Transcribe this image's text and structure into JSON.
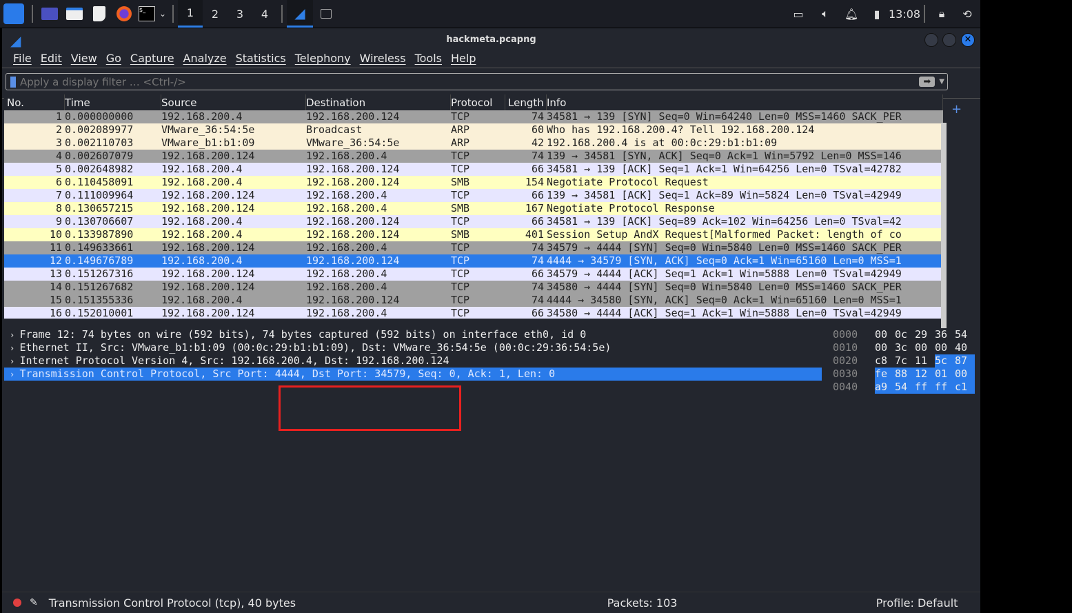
{
  "taskbar": {
    "workspaces": [
      "1",
      "2",
      "3",
      "4"
    ],
    "active_workspace": "1",
    "clock": "13:08"
  },
  "window": {
    "title": "hackmeta.pcapng"
  },
  "menu": [
    "File",
    "Edit",
    "View",
    "Go",
    "Capture",
    "Analyze",
    "Statistics",
    "Telephony",
    "Wireless",
    "Tools",
    "Help"
  ],
  "filter": {
    "placeholder": "Apply a display filter … <Ctrl-/>"
  },
  "columns": [
    "No.",
    "Time",
    "Source",
    "Destination",
    "Protocol",
    "Length",
    "Info"
  ],
  "colors": {
    "syn": "#a0a0a0",
    "arp": "#faf0d7",
    "tcp": "#e7e6ff",
    "smb": "#ffffc0",
    "selected": "#2a7bea",
    "accent": "#2f7fe6"
  },
  "packets": [
    [
      "1",
      "0.000000000",
      "192.168.200.4",
      "192.168.200.124",
      "TCP",
      "74",
      "34581 → 139 [SYN] Seq=0 Win=64240 Len=0 MSS=1460 SACK_PER",
      "syn"
    ],
    [
      "2",
      "0.002089977",
      "VMware_36:54:5e",
      "Broadcast",
      "ARP",
      "60",
      "Who has 192.168.200.4? Tell 192.168.200.124",
      "arp"
    ],
    [
      "3",
      "0.002110703",
      "VMware_b1:b1:09",
      "VMware_36:54:5e",
      "ARP",
      "42",
      "192.168.200.4 is at 00:0c:29:b1:b1:09",
      "arp"
    ],
    [
      "4",
      "0.002607079",
      "192.168.200.124",
      "192.168.200.4",
      "TCP",
      "74",
      "139 → 34581 [SYN, ACK] Seq=0 Ack=1 Win=5792 Len=0 MSS=146",
      "syn"
    ],
    [
      "5",
      "0.002648982",
      "192.168.200.4",
      "192.168.200.124",
      "TCP",
      "66",
      "34581 → 139 [ACK] Seq=1 Ack=1 Win=64256 Len=0 TSval=42782",
      "tcp"
    ],
    [
      "6",
      "0.110458091",
      "192.168.200.4",
      "192.168.200.124",
      "SMB",
      "154",
      "Negotiate Protocol Request",
      "smb"
    ],
    [
      "7",
      "0.111009964",
      "192.168.200.124",
      "192.168.200.4",
      "TCP",
      "66",
      "139 → 34581 [ACK] Seq=1 Ack=89 Win=5824 Len=0 TSval=42949",
      "tcp"
    ],
    [
      "8",
      "0.130657215",
      "192.168.200.124",
      "192.168.200.4",
      "SMB",
      "167",
      "Negotiate Protocol Response",
      "smb"
    ],
    [
      "9",
      "0.130706607",
      "192.168.200.4",
      "192.168.200.124",
      "TCP",
      "66",
      "34581 → 139 [ACK] Seq=89 Ack=102 Win=64256 Len=0 TSval=42",
      "tcp"
    ],
    [
      "10",
      "0.133987890",
      "192.168.200.4",
      "192.168.200.124",
      "SMB",
      "401",
      "Session Setup AndX Request[Malformed Packet: length of co",
      "smb"
    ],
    [
      "11",
      "0.149633661",
      "192.168.200.124",
      "192.168.200.4",
      "TCP",
      "74",
      "34579 → 4444 [SYN] Seq=0 Win=5840 Len=0 MSS=1460 SACK_PER",
      "syn"
    ],
    [
      "12",
      "0.149676789",
      "192.168.200.4",
      "192.168.200.124",
      "TCP",
      "74",
      "4444 → 34579 [SYN, ACK] Seq=0 Ack=1 Win=65160 Len=0 MSS=1",
      "selected"
    ],
    [
      "13",
      "0.151267316",
      "192.168.200.124",
      "192.168.200.4",
      "TCP",
      "66",
      "34579 → 4444 [ACK] Seq=1 Ack=1 Win=5888 Len=0 TSval=42949",
      "tcp"
    ],
    [
      "14",
      "0.151267682",
      "192.168.200.124",
      "192.168.200.4",
      "TCP",
      "74",
      "34580 → 4444 [SYN] Seq=0 Win=5840 Len=0 MSS=1460 SACK_PER",
      "syn"
    ],
    [
      "15",
      "0.151355336",
      "192.168.200.4",
      "192.168.200.124",
      "TCP",
      "74",
      "4444 → 34580 [SYN, ACK] Seq=0 Ack=1 Win=65160 Len=0 MSS=1",
      "syn"
    ],
    [
      "16",
      "0.152010001",
      "192.168.200.124",
      "192.168.200.4",
      "TCP",
      "66",
      "34580 → 4444 [ACK] Seq=1 Ack=1 Win=5888 Len=0 TSval=42949",
      "tcp"
    ]
  ],
  "details": [
    "Frame 12: 74 bytes on wire (592 bits), 74 bytes captured (592 bits) on interface eth0, id 0",
    "Ethernet II, Src: VMware_b1:b1:09 (00:0c:29:b1:b1:09), Dst: VMware_36:54:5e (00:0c:29:36:54:5e)",
    "Internet Protocol Version 4, Src: 192.168.200.4, Dst: 192.168.200.124",
    "Transmission Control Protocol, Src Port: 4444, Dst Port: 34579, Seq: 0, Ack: 1, Len: 0"
  ],
  "hex": [
    {
      "offset": "0000",
      "bytes": [
        "00",
        "0c",
        "29",
        "36",
        "54"
      ],
      "hl": 0
    },
    {
      "offset": "0010",
      "bytes": [
        "00",
        "3c",
        "00",
        "00",
        "40"
      ],
      "hl": 0
    },
    {
      "offset": "0020",
      "bytes": [
        "c8",
        "7c",
        "11",
        "5c",
        "87"
      ],
      "hl": 2
    },
    {
      "offset": "0030",
      "bytes": [
        "fe",
        "88",
        "12",
        "01",
        "00"
      ],
      "hl": 5
    },
    {
      "offset": "0040",
      "bytes": [
        "a9",
        "54",
        "ff",
        "ff",
        "c1"
      ],
      "hl": 5
    }
  ],
  "status": {
    "selection": "Transmission Control Protocol (tcp), 40 bytes",
    "packets": "Packets: 103",
    "profile": "Profile: Default"
  }
}
